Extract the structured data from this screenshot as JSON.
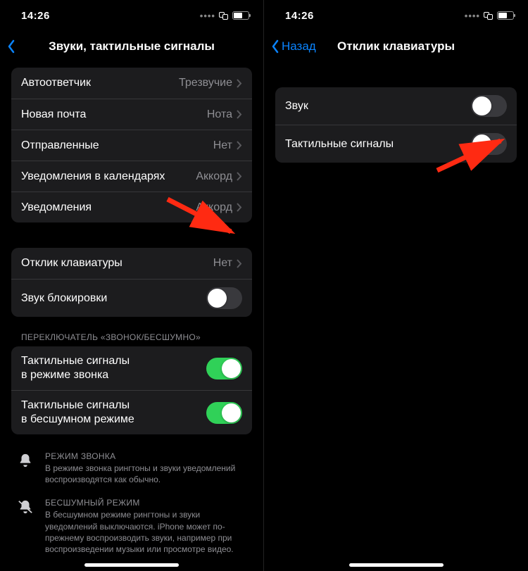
{
  "left": {
    "status_time": "14:26",
    "nav_title": "Звуки, тактильные сигналы",
    "rows1": [
      {
        "label": "Автоответчик",
        "value": "Трезвучие"
      },
      {
        "label": "Новая почта",
        "value": "Нота"
      },
      {
        "label": "Отправленные",
        "value": "Нет"
      },
      {
        "label": "Уведомления в календарях",
        "value": "Аккорд"
      },
      {
        "label": "Уведомления",
        "value": "Аккорд"
      }
    ],
    "rows2": {
      "keyboard": {
        "label": "Отклик клавиатуры",
        "value": "Нет"
      },
      "lock": {
        "label": "Звук блокировки",
        "on": false
      }
    },
    "section2_header": "ПЕРЕКЛЮЧАТЕЛЬ «ЗВОНОК/БЕСШУМНО»",
    "rows3": {
      "r1": {
        "label": "Тактильные сигналы\nв режиме звонка",
        "on": true
      },
      "r2": {
        "label": "Тактильные сигналы\nв бесшумном режиме",
        "on": true
      }
    },
    "foot1_title": "РЕЖИМ ЗВОНКА",
    "foot1_body": "В режиме звонка рингтоны и звуки уведомлений воспроизводятся как обычно.",
    "foot2_title": "БЕСШУМНЫЙ РЕЖИМ",
    "foot2_body": "В бесшумном режиме рингтоны и звуки уведомлений выключаются. iPhone может по-прежнему воспроизводить звуки, например при воспроизведении музыки или просмотре видео."
  },
  "right": {
    "status_time": "14:26",
    "nav_back": "Назад",
    "nav_title": "Отклик клавиатуры",
    "rows": {
      "sound": {
        "label": "Звук",
        "on": false
      },
      "haptic": {
        "label": "Тактильные сигналы",
        "on": false
      }
    }
  }
}
